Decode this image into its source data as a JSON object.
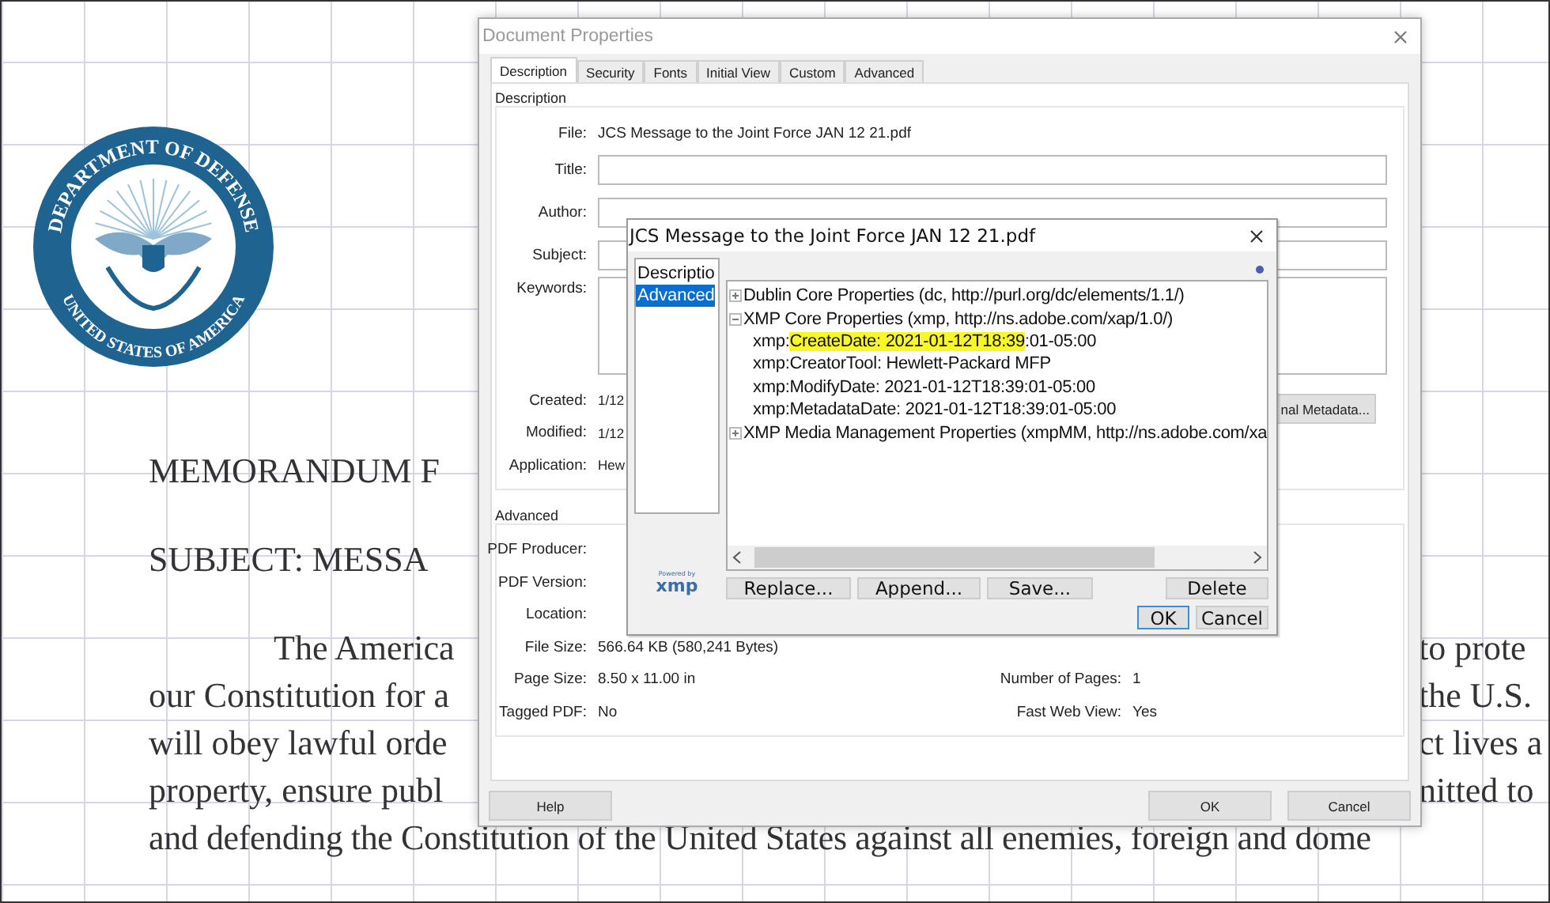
{
  "document": {
    "seal": {
      "top_text": "DEPARTMENT OF DEFENSE",
      "bottom_text": "UNITED STATES OF AMERICA"
    },
    "heading_lines": [
      "MEMORANDUM F",
      "SUBJECT:  MESSA"
    ],
    "paragraph_rows": [
      {
        "left": "The America",
        "right": "to prote",
        "indent": true
      },
      {
        "left": "our Constitution for a",
        "right": "the U.S."
      },
      {
        "left": "will obey lawful orde",
        "right": "ct lives a"
      },
      {
        "left": "property, ensure publ",
        "right": "nitted to"
      }
    ],
    "last_line": "and defending the Constitution of the United States against all enemies, foreign and dome"
  },
  "properties_dialog": {
    "title": "Document Properties",
    "tabs": [
      {
        "label": "Description",
        "selected": true
      },
      {
        "label": "Security",
        "selected": false
      },
      {
        "label": "Fonts",
        "selected": false
      },
      {
        "label": "Initial View",
        "selected": false
      },
      {
        "label": "Custom",
        "selected": false
      },
      {
        "label": "Advanced",
        "selected": false
      }
    ],
    "description_group": {
      "title": "Description",
      "file": {
        "label": "File:",
        "value": "JCS Message to the Joint Force JAN 12 21.pdf"
      },
      "fields": [
        {
          "label": "Title:",
          "kind": "line"
        },
        {
          "label": "Author:",
          "kind": "line"
        },
        {
          "label": "Subject:",
          "kind": "line"
        },
        {
          "label": "Keywords:",
          "kind": "area"
        }
      ],
      "info": [
        {
          "label": "Created:",
          "value": "1/12"
        },
        {
          "label": "Modified:",
          "value": "1/12"
        },
        {
          "label": "Application:",
          "value": "Hew"
        }
      ],
      "metadata_button": "nal Metadata..."
    },
    "advanced_group": {
      "title": "Advanced",
      "rows": [
        {
          "label": "PDF Producer:"
        },
        {
          "label": "PDF Version:"
        },
        {
          "label": "Location:"
        },
        {
          "label": "File Size:",
          "value": "566.64 KB (580,241 Bytes)"
        },
        {
          "label": "Page Size:",
          "value": "8.50 x 11.00 in",
          "label_2": "Number of Pages:",
          "value_2": "1"
        },
        {
          "label": "Tagged PDF:",
          "value": "No",
          "label_2": "Fast Web View:",
          "value_2": "Yes"
        }
      ]
    },
    "buttons": {
      "help": "Help",
      "ok": "OK",
      "cancel": "Cancel"
    }
  },
  "metadata_dialog": {
    "title": "JCS Message to the Joint Force JAN 12 21.pdf",
    "categories": [
      {
        "label": "Descriptio",
        "selected": false
      },
      {
        "label": "Advanced",
        "selected": true
      }
    ],
    "tree": [
      {
        "label": "Dublin Core Properties (dc, http://purl.org/dc/elements/1.1/)",
        "expanded": false
      },
      {
        "label": "XMP Core Properties (xmp, http://ns.adobe.com/xap/1.0/)",
        "expanded": true,
        "children": [
          {
            "parts": [
              {
                "text": "xmp:"
              },
              {
                "text": "CreateDate: 2021-01-12T18:39",
                "highlighted": true
              },
              {
                "text": ":01-05:00"
              }
            ]
          },
          {
            "parts": [
              {
                "text": "xmp:CreatorTool: Hewlett-Packard MFP"
              }
            ]
          },
          {
            "parts": [
              {
                "text": "xmp:ModifyDate: 2021-01-12T18:39:01-05:00"
              }
            ]
          },
          {
            "parts": [
              {
                "text": "xmp:MetadataDate: 2021-01-12T18:39:01-05:00"
              }
            ]
          }
        ]
      },
      {
        "label": "XMP Media Management Properties (xmpMM, http://ns.adobe.com/xa",
        "expanded": false
      }
    ],
    "logo": {
      "caption": "Powered by",
      "text": "xmp"
    },
    "actions": [
      "Replace...",
      "Append...",
      "Save..."
    ],
    "delete": "Delete",
    "ok": "OK",
    "cancel": "Cancel"
  }
}
